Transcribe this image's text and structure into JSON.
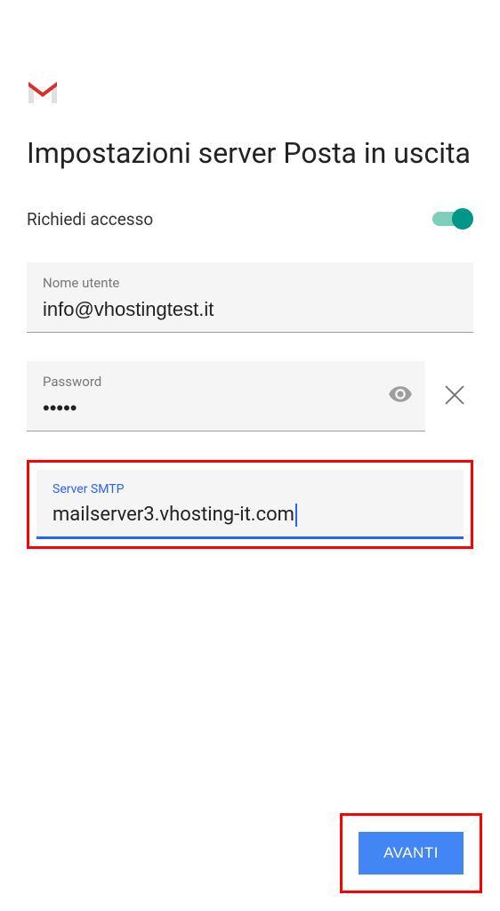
{
  "title": "Impostazioni server Posta in uscita",
  "toggle": {
    "label": "Richiedi accesso",
    "enabled": true
  },
  "username": {
    "label": "Nome utente",
    "value": "info@vhostingtest.it"
  },
  "password": {
    "label": "Password",
    "value": "•••••"
  },
  "smtp": {
    "label": "Server SMTP",
    "value": "mailserver3.vhosting-it.com"
  },
  "button": {
    "next": "AVANTI"
  }
}
